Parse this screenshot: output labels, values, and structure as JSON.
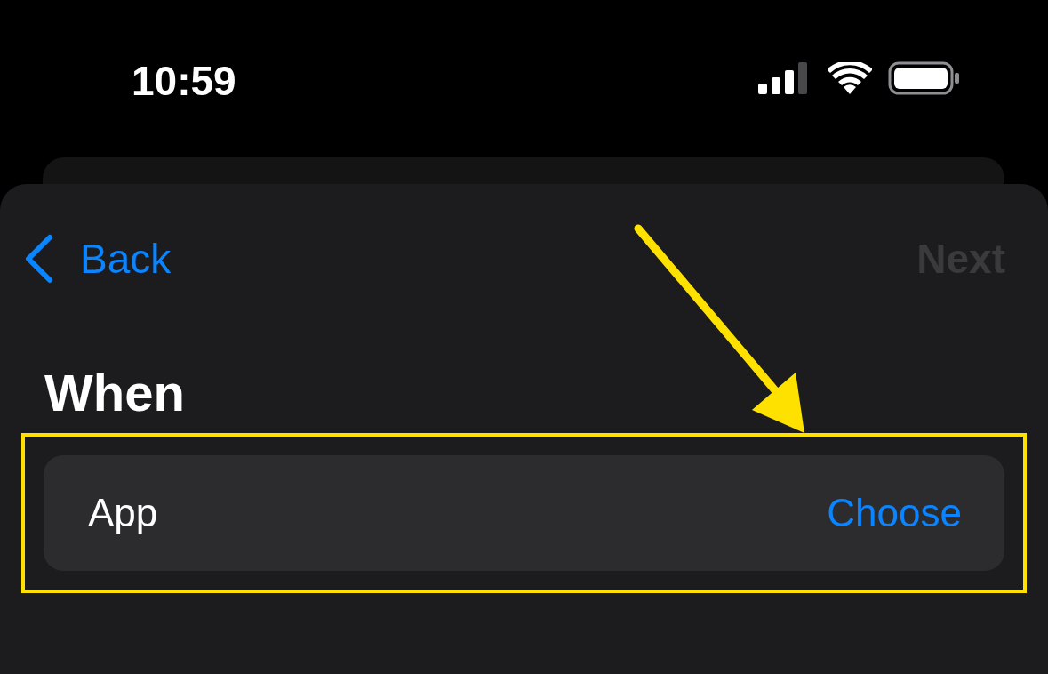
{
  "status_bar": {
    "time": "10:59"
  },
  "nav": {
    "back": {
      "label": "Back"
    },
    "next": {
      "label": "Next",
      "disabled": true
    }
  },
  "section": {
    "title": "When"
  },
  "rows": [
    {
      "label": "App",
      "action": "Choose",
      "highlighted": true
    }
  ],
  "callout_arrow": true
}
